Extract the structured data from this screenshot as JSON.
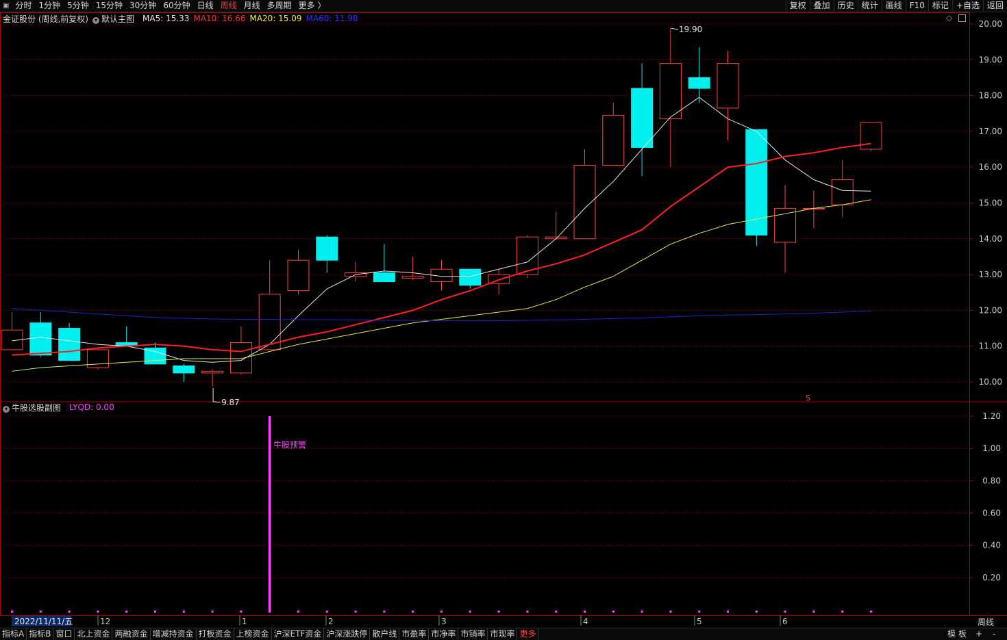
{
  "toolbar": {
    "window_icon": "window-restore-icon",
    "tabs": [
      "分时",
      "1分钟",
      "5分钟",
      "15分钟",
      "30分钟",
      "60分钟",
      "日线",
      "周线",
      "月线",
      "多周期",
      "更多 〉"
    ],
    "active_tab": "周线",
    "right_tools": [
      "复权",
      "叠加",
      "历史",
      "统计",
      "画线",
      "F10",
      "标记",
      "+自选",
      "返回"
    ]
  },
  "main_legend": {
    "stock": "金证股份 (周线,前复权)",
    "indicator": "默认主图",
    "ma5": "MA5: 15.33",
    "ma10": "MA10: 16.66",
    "ma20": "MA20: 15.09",
    "ma60": "MA60: 11.98"
  },
  "sub_legend": {
    "name": "牛股选股副图",
    "lyqd": "LYQD: 0.00",
    "signal_label": "牛股预警"
  },
  "annotations": {
    "high_label": "19.90",
    "low_label": "9.87",
    "marker": "S"
  },
  "colors": {
    "up": "#ff4040",
    "down": "#00f0f0",
    "ma5": "#e8e8e8",
    "ma10": "#ff2020",
    "ma20": "#e8e84a",
    "ma60": "#2020d0",
    "signal": "#ff40ff",
    "axis": "#b00000"
  },
  "chart_data": [
    {
      "type": "candlestick",
      "title": "金证股份 (周线,前复权)",
      "price_axis_ticks": [
        "20.00",
        "19.00",
        "18.00",
        "17.00",
        "16.00",
        "15.00",
        "14.00",
        "13.00",
        "12.00",
        "11.00",
        "10.00"
      ],
      "ylim": [
        9.6,
        20.3
      ],
      "x_labels": [
        "12",
        "1",
        "2",
        "3",
        "4",
        "5",
        "6"
      ],
      "current_date": "2022/11/11/五",
      "candles": [
        {
          "o": 10.9,
          "c": 11.45,
          "h": 11.95,
          "l": 10.9
        },
        {
          "o": 11.65,
          "c": 10.75,
          "h": 11.95,
          "l": 10.7
        },
        {
          "o": 11.5,
          "c": 10.6,
          "h": 11.65,
          "l": 10.6
        },
        {
          "o": 10.4,
          "c": 10.9,
          "h": 10.95,
          "l": 10.35
        },
        {
          "o": 11.1,
          "c": 11.0,
          "h": 11.55,
          "l": 11.0
        },
        {
          "o": 10.95,
          "c": 10.5,
          "h": 11.1,
          "l": 10.5
        },
        {
          "o": 10.45,
          "c": 10.25,
          "h": 10.5,
          "l": 10.0
        },
        {
          "o": 10.25,
          "c": 10.3,
          "h": 10.35,
          "l": 9.87
        },
        {
          "o": 10.25,
          "c": 11.1,
          "h": 11.55,
          "l": 10.2
        },
        {
          "o": 10.9,
          "c": 12.45,
          "h": 13.4,
          "l": 10.9
        },
        {
          "o": 12.55,
          "c": 13.4,
          "h": 13.7,
          "l": 12.45
        },
        {
          "o": 14.05,
          "c": 13.4,
          "h": 14.1,
          "l": 13.05
        },
        {
          "o": 12.95,
          "c": 13.05,
          "h": 13.35,
          "l": 12.8
        },
        {
          "o": 13.05,
          "c": 12.8,
          "h": 13.85,
          "l": 12.8
        },
        {
          "o": 12.9,
          "c": 12.95,
          "h": 13.5,
          "l": 12.85
        },
        {
          "o": 12.8,
          "c": 13.15,
          "h": 13.4,
          "l": 12.55
        },
        {
          "o": 13.15,
          "c": 12.7,
          "h": 13.15,
          "l": 12.6
        },
        {
          "o": 12.75,
          "c": 13.0,
          "h": 13.15,
          "l": 12.45
        },
        {
          "o": 13.0,
          "c": 14.05,
          "h": 14.1,
          "l": 12.9
        },
        {
          "o": 14.0,
          "c": 14.05,
          "h": 14.75,
          "l": 14.0
        },
        {
          "o": 14.0,
          "c": 16.05,
          "h": 16.5,
          "l": 14.0
        },
        {
          "o": 16.05,
          "c": 17.45,
          "h": 17.8,
          "l": 16.05
        },
        {
          "o": 18.2,
          "c": 16.55,
          "h": 18.9,
          "l": 15.75
        },
        {
          "o": 17.35,
          "c": 18.9,
          "h": 19.9,
          "l": 16.0
        },
        {
          "o": 18.5,
          "c": 18.2,
          "h": 19.35,
          "l": 17.8
        },
        {
          "o": 17.65,
          "c": 18.9,
          "h": 19.25,
          "l": 16.75
        },
        {
          "o": 17.05,
          "c": 14.1,
          "h": 17.05,
          "l": 13.8
        },
        {
          "o": 13.9,
          "c": 14.85,
          "h": 15.5,
          "l": 13.05
        },
        {
          "o": 14.85,
          "c": 14.85,
          "h": 15.35,
          "l": 14.3
        },
        {
          "o": 14.95,
          "c": 15.65,
          "h": 16.2,
          "l": 14.6
        },
        {
          "o": 16.5,
          "c": 17.25,
          "h": 17.25,
          "l": 16.45
        }
      ],
      "series": [
        {
          "name": "MA5",
          "values": [
            11.15,
            11.25,
            11.15,
            11.05,
            11.0,
            10.85,
            10.6,
            10.55,
            10.6,
            11.05,
            11.85,
            12.6,
            13.0,
            13.1,
            13.05,
            12.95,
            12.95,
            13.15,
            13.35,
            14.0,
            14.85,
            15.6,
            16.5,
            17.4,
            17.95,
            17.35,
            17.0,
            16.2,
            15.65,
            15.35,
            15.33
          ]
        },
        {
          "name": "MA10",
          "values": [
            10.75,
            10.8,
            10.85,
            10.95,
            11.0,
            11.05,
            11.0,
            10.9,
            10.85,
            11.05,
            11.25,
            11.4,
            11.6,
            11.8,
            12.0,
            12.3,
            12.55,
            12.85,
            13.1,
            13.3,
            13.55,
            13.9,
            14.25,
            14.9,
            15.45,
            16.0,
            16.1,
            16.3,
            16.4,
            16.55,
            16.66
          ]
        },
        {
          "name": "MA20",
          "values": [
            10.3,
            10.4,
            10.45,
            10.5,
            10.55,
            10.6,
            10.65,
            10.65,
            10.65,
            10.85,
            11.05,
            11.2,
            11.35,
            11.5,
            11.65,
            11.75,
            11.85,
            11.95,
            12.05,
            12.3,
            12.65,
            12.95,
            13.4,
            13.85,
            14.15,
            14.4,
            14.55,
            14.7,
            14.85,
            14.95,
            15.09
          ]
        },
        {
          "name": "MA60",
          "values": [
            12.05,
            12.0,
            11.95,
            11.9,
            11.85,
            11.8,
            11.78,
            11.76,
            11.75,
            11.75,
            11.74,
            11.74,
            11.73,
            11.72,
            11.72,
            11.71,
            11.71,
            11.71,
            11.72,
            11.73,
            11.75,
            11.77,
            11.79,
            11.82,
            11.85,
            11.87,
            11.88,
            11.9,
            11.92,
            11.95,
            11.98
          ]
        }
      ]
    },
    {
      "type": "bar",
      "title": "牛股选股副图",
      "axis_ticks": [
        "1.20",
        "1.00",
        "0.80",
        "0.60",
        "0.40",
        "0.20"
      ],
      "ylim": [
        0,
        1.22
      ],
      "signal_index": 9,
      "signal_value": 1.2
    }
  ],
  "footer": {
    "tabs": [
      "指标A",
      "指标B",
      "窗口",
      "北上资金",
      "两融资金",
      "增减持资金",
      "打板资金",
      "上榜资金",
      "沪深ETF资金",
      "沪深涨跌停",
      "散户线",
      "市盈率",
      "市净率",
      "市销率",
      "市现率",
      "更多"
    ],
    "right": [
      "模",
      "板",
      "+",
      "-"
    ],
    "period": "周线"
  }
}
